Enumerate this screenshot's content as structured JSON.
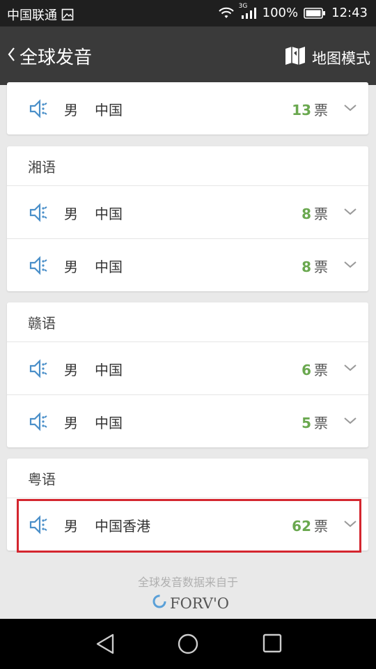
{
  "status_bar": {
    "carrier": "中国联通",
    "network": "3G",
    "battery": "100%",
    "time": "12:43"
  },
  "header": {
    "back_icon": "chevron-left-icon",
    "title": "全球发音",
    "map_mode_icon": "map-icon",
    "map_mode_label": "地图模式"
  },
  "groups": [
    {
      "title": "",
      "rows": [
        {
          "gender": "男",
          "country": "中国",
          "votes": "13",
          "unit": "票"
        }
      ]
    },
    {
      "title": "湘语",
      "rows": [
        {
          "gender": "男",
          "country": "中国",
          "votes": "8",
          "unit": "票"
        },
        {
          "gender": "男",
          "country": "中国",
          "votes": "8",
          "unit": "票"
        }
      ]
    },
    {
      "title": "赣语",
      "rows": [
        {
          "gender": "男",
          "country": "中国",
          "votes": "6",
          "unit": "票"
        },
        {
          "gender": "男",
          "country": "中国",
          "votes": "5",
          "unit": "票"
        }
      ]
    },
    {
      "title": "粤语",
      "rows": [
        {
          "gender": "男",
          "country": "中国香港",
          "votes": "62",
          "unit": "票"
        }
      ]
    }
  ],
  "footer": {
    "source_text": "全球发音数据来自于",
    "logo_text": "FORV'O"
  },
  "nav_bar": {
    "back_icon": "triangle-back-icon",
    "home_icon": "circle-home-icon",
    "recents_icon": "square-recents-icon"
  },
  "colors": {
    "accent_green": "#6aa84f",
    "speaker_blue": "#4a8fc9",
    "highlight_red": "#d4262f"
  }
}
